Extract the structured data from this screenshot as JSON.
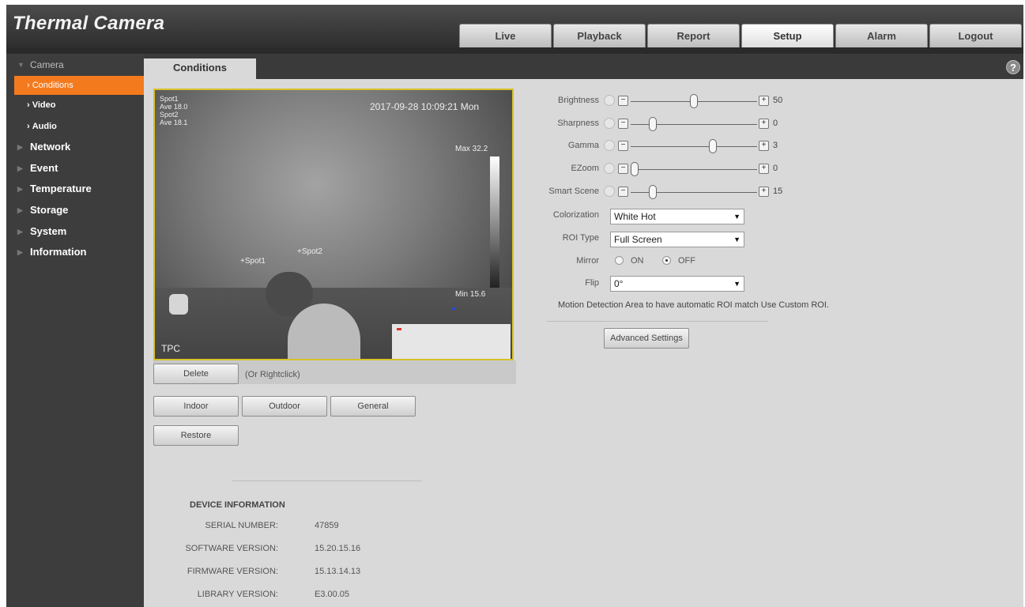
{
  "app": {
    "title": "Thermal Camera"
  },
  "nav": {
    "tabs": [
      "Live",
      "Playback",
      "Report",
      "Setup",
      "Alarm",
      "Logout"
    ],
    "active": "Setup"
  },
  "sidebar": {
    "camera": "Camera",
    "camera_items": [
      "Conditions",
      "Video",
      "Audio"
    ],
    "categories": [
      "Network",
      "Event",
      "Temperature",
      "Storage",
      "System",
      "Information"
    ]
  },
  "page": {
    "tab": "Conditions",
    "help_icon": "question-mark-icon"
  },
  "video": {
    "spot_info": "Spot1\nAve 18.0\nSpot2\nAve 18.1",
    "timestamp": "2017-09-28 10:09:21 Mon",
    "max": "Max 32.2",
    "min": "Min 15.6",
    "tpc": "TPC",
    "spot1": "+Spot1",
    "spot2": "+Spot2"
  },
  "buttons": {
    "delete": "Delete",
    "delete_hint": "(Or Rightclick)",
    "indoor": "Indoor",
    "outdoor": "Outdoor",
    "general": "General",
    "restore": "Restore",
    "advanced": "Advanced Settings"
  },
  "sliders": [
    {
      "label": "Brightness",
      "value": "50",
      "level": 0.5,
      "icon": "sun-icon"
    },
    {
      "label": "Sharpness",
      "value": "0",
      "level": 0.15,
      "icon": "triangle-icon"
    },
    {
      "label": "Gamma",
      "value": "3",
      "level": 0.66,
      "icon": "pencil-icon"
    },
    {
      "label": "EZoom",
      "value": "0",
      "level": 0.0,
      "icon": "magnifier-icon"
    },
    {
      "label": "Smart Scene",
      "value": "15",
      "level": 0.15,
      "icon": "gear-icon"
    }
  ],
  "colorization": {
    "label": "Colorization",
    "value": "White Hot"
  },
  "roi_type": {
    "label": "ROI Type",
    "value": "Full Screen"
  },
  "mirror": {
    "label": "Mirror",
    "on": "ON",
    "off": "OFF",
    "selected": "OFF"
  },
  "flip": {
    "label": "Flip",
    "value": "0°"
  },
  "note": "Motion Detection Area to have automatic ROI match Use Custom ROI.",
  "device": {
    "title": "DEVICE INFORMATION",
    "rows": [
      {
        "label": "SERIAL NUMBER:",
        "value": "47859"
      },
      {
        "label": "SOFTWARE VERSION:",
        "value": "15.20.15.16"
      },
      {
        "label": "FIRMWARE VERSION:",
        "value": "15.13.14.13"
      },
      {
        "label": "LIBRARY VERSION:",
        "value": "E3.00.05"
      }
    ]
  }
}
